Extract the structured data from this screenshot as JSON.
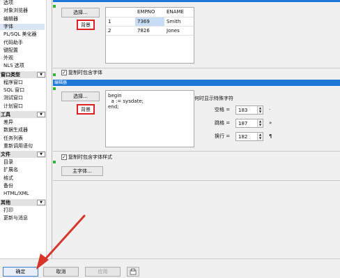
{
  "sidebar": {
    "items": [
      {
        "label": "选项",
        "kind": "item"
      },
      {
        "label": "对象浏览器",
        "kind": "item"
      },
      {
        "label": "编辑器",
        "kind": "item"
      },
      {
        "label": "字体",
        "kind": "item",
        "selected": true
      },
      {
        "label": "PL/SQL 美化器",
        "kind": "item"
      },
      {
        "label": "代码助手",
        "kind": "item"
      },
      {
        "label": "键配置",
        "kind": "item"
      },
      {
        "label": "外观",
        "kind": "item"
      },
      {
        "label": "NLS 选项",
        "kind": "item"
      },
      {
        "label": "窗口类型",
        "kind": "header"
      },
      {
        "label": "程序窗口",
        "kind": "item"
      },
      {
        "label": "SQL 窗口",
        "kind": "item"
      },
      {
        "label": "测试窗口",
        "kind": "item"
      },
      {
        "label": "计划窗口",
        "kind": "item"
      },
      {
        "label": "工具",
        "kind": "header"
      },
      {
        "label": "差异",
        "kind": "item"
      },
      {
        "label": "数据生成器",
        "kind": "item"
      },
      {
        "label": "任务列表",
        "kind": "item"
      },
      {
        "label": "重新调用语句",
        "kind": "item"
      },
      {
        "label": "文件",
        "kind": "header"
      },
      {
        "label": "目录",
        "kind": "item"
      },
      {
        "label": "扩展名",
        "kind": "item"
      },
      {
        "label": "格式",
        "kind": "item"
      },
      {
        "label": "备份",
        "kind": "item"
      },
      {
        "label": "HTML/XML",
        "kind": "item"
      },
      {
        "label": "其他",
        "kind": "header"
      },
      {
        "label": "打印",
        "kind": "item"
      },
      {
        "label": "更新与消息",
        "kind": "item"
      }
    ]
  },
  "grid_section": {
    "select_button": "选择...",
    "background_button": "背景",
    "columns": [
      "",
      "EMPNO",
      "ENAME"
    ],
    "rows": [
      [
        "1",
        "7369",
        "Smith"
      ],
      [
        "2",
        "7826",
        "Jones"
      ]
    ],
    "highlight_color": "#c7ddf5",
    "copy_checkbox_label": "复制时包含字体",
    "copy_checked": true
  },
  "editor_section": {
    "title": "编辑器",
    "select_button": "选择...",
    "background_button": "背景",
    "code_lines": [
      "begin",
      "  a := sysdate;",
      "end;"
    ],
    "special_chars_title": "何时显示特殊字符",
    "special": [
      {
        "label": "空格 =",
        "value": "183",
        "char": "·"
      },
      {
        "label": "跳格 =",
        "value": "187",
        "char": "»"
      },
      {
        "label": "换行 =",
        "value": "182",
        "char": "¶"
      }
    ],
    "copy_checkbox_label": "复制时包含字体样式",
    "copy_checked": true
  },
  "main_font_button": "主字体...",
  "footer": {
    "ok": "确定",
    "cancel": "取消",
    "apply": "应用",
    "help_icon": "help-icon"
  },
  "colors": {
    "accent_blue": "#1d77d6",
    "highlight_red": "#e02020",
    "arrow_red": "#d8352a",
    "green_marker": "#2fb52f"
  }
}
